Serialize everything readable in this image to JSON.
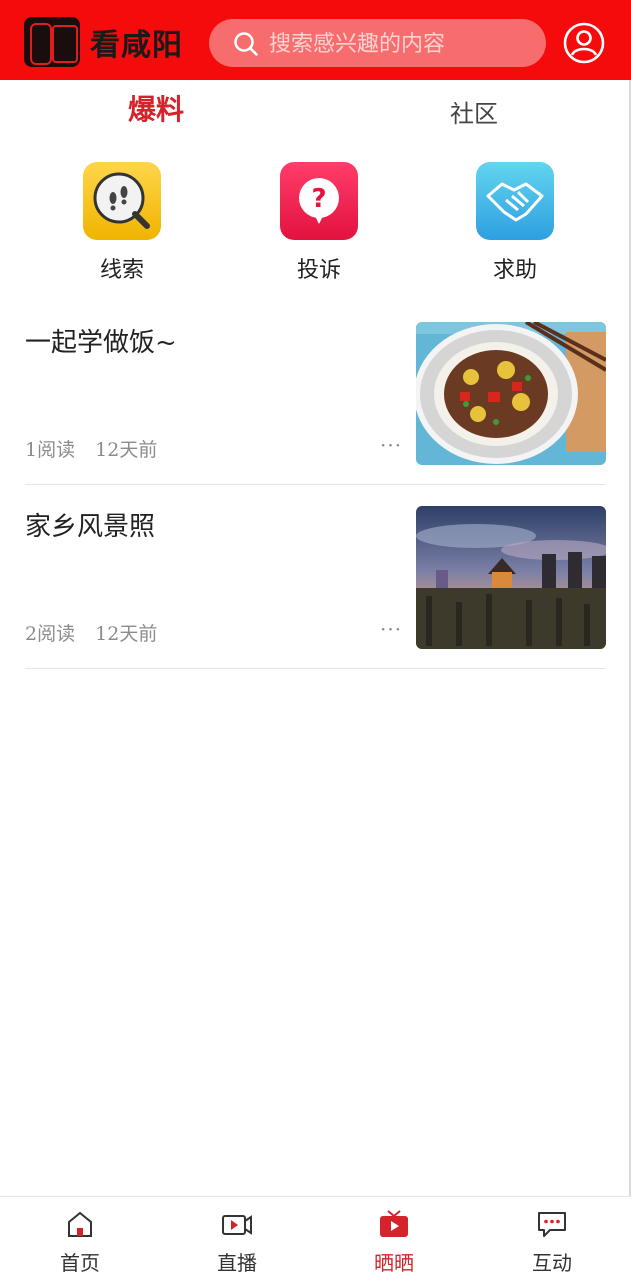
{
  "header": {
    "app_title": "看咸阳",
    "search_placeholder": "搜索感兴趣的内容"
  },
  "tabs": [
    {
      "label": "爆料",
      "active": true
    },
    {
      "label": "社区",
      "active": false
    }
  ],
  "categories": [
    {
      "label": "线索",
      "icon": "magnifier-footprints-icon"
    },
    {
      "label": "投诉",
      "icon": "question-bubble-icon"
    },
    {
      "label": "求助",
      "icon": "handshake-icon"
    }
  ],
  "feed": [
    {
      "title": "一起学做饭~",
      "reads": "1阅读",
      "time": "12天前",
      "more": "···",
      "image": "braised-beef-dish-photo"
    },
    {
      "title": "家乡风景照",
      "reads": "2阅读",
      "time": "12天前",
      "more": "···",
      "image": "city-dusk-tower-photo"
    }
  ],
  "bottom_nav": [
    {
      "label": "首页",
      "icon": "home-icon",
      "active": false
    },
    {
      "label": "直播",
      "icon": "video-camera-icon",
      "active": false
    },
    {
      "label": "晒晒",
      "icon": "tv-icon",
      "active": true
    },
    {
      "label": "互动",
      "icon": "chat-bubble-icon",
      "active": false
    }
  ],
  "colors": {
    "brand_red": "#f50b0b",
    "active_tab": "#d4232a",
    "meta_gray": "#8c8c8c"
  }
}
